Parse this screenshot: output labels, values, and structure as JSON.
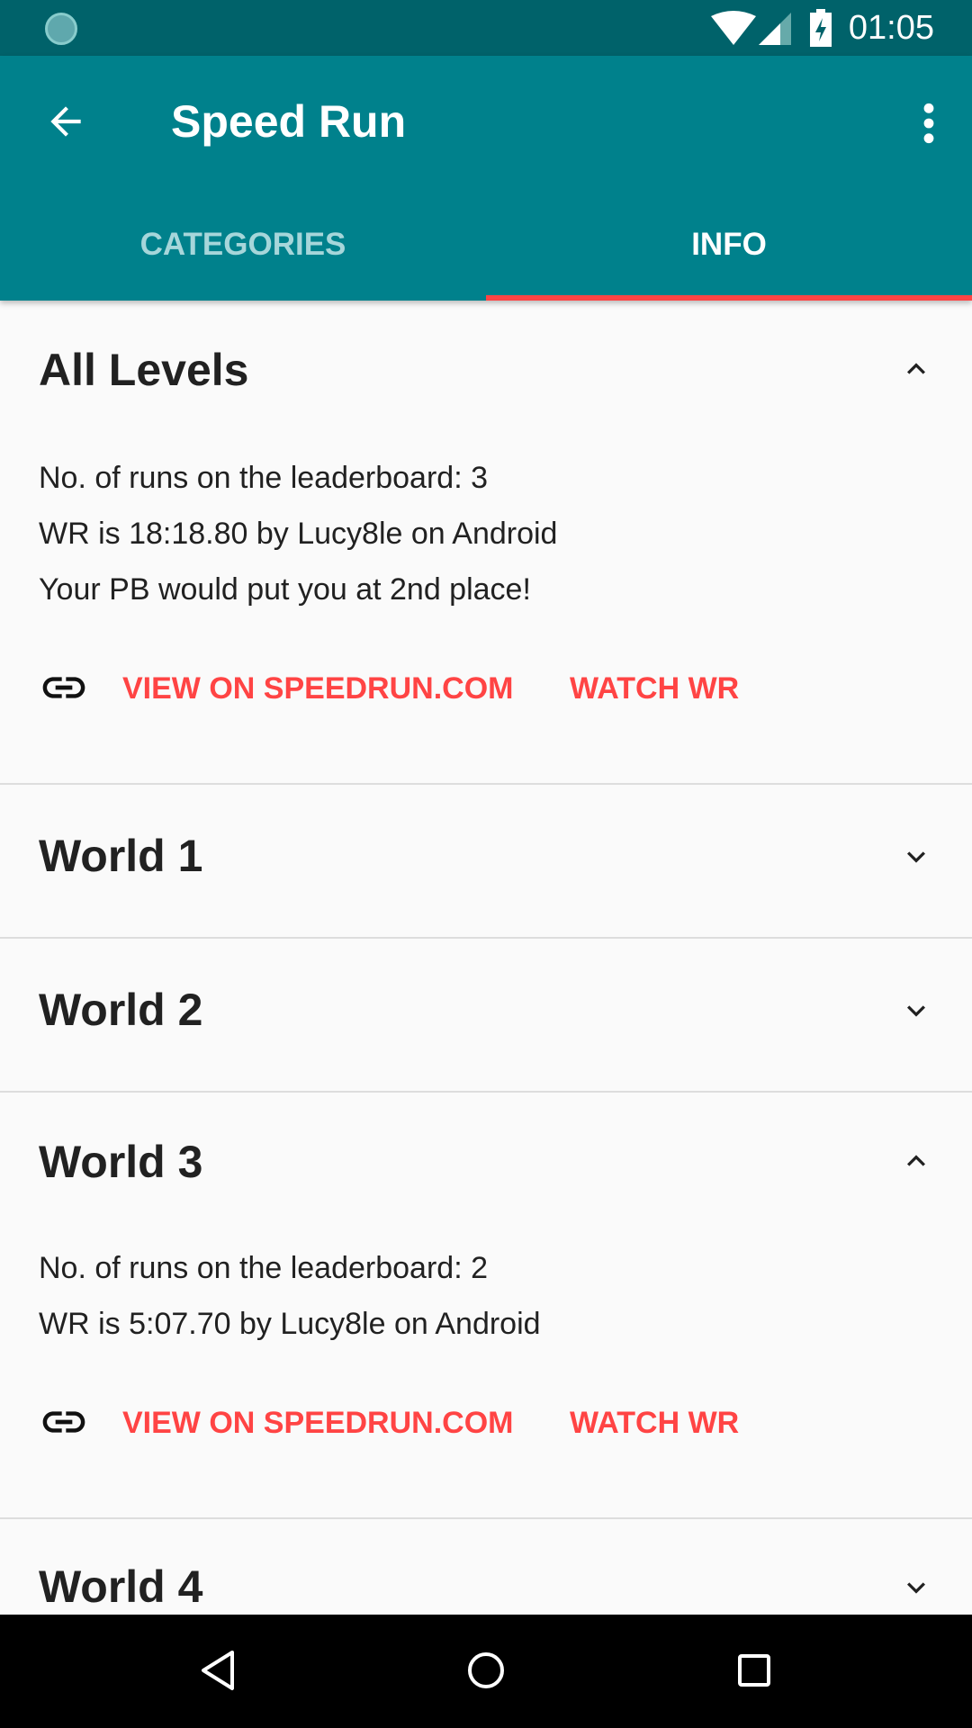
{
  "status_bar": {
    "time": "01:05",
    "icons": [
      "wifi-icon",
      "signal-icon",
      "battery-charging-icon"
    ]
  },
  "app_bar": {
    "title": "Speed Run",
    "tabs": [
      {
        "label": "CATEGORIES",
        "selected": false
      },
      {
        "label": "INFO",
        "selected": true
      }
    ]
  },
  "colors": {
    "primary": "#00818c",
    "status": "#00626a",
    "accent": "#ff4444"
  },
  "sections": [
    {
      "title": "All Levels",
      "expanded": true,
      "lines": [
        "No. of runs on the leaderboard: 3",
        "WR is 18:18.80 by Lucy8le on Android",
        "Your PB would put you at 2nd place!"
      ],
      "view_label": "VIEW ON SPEEDRUN.COM",
      "watch_label": "WATCH WR"
    },
    {
      "title": "World 1",
      "expanded": false
    },
    {
      "title": "World 2",
      "expanded": false
    },
    {
      "title": "World 3",
      "expanded": true,
      "lines": [
        "No. of runs on the leaderboard: 2",
        "WR is 5:07.70 by Lucy8le on Android"
      ],
      "view_label": "VIEW ON SPEEDRUN.COM",
      "watch_label": "WATCH WR"
    },
    {
      "title": "World 4",
      "expanded": false
    }
  ]
}
